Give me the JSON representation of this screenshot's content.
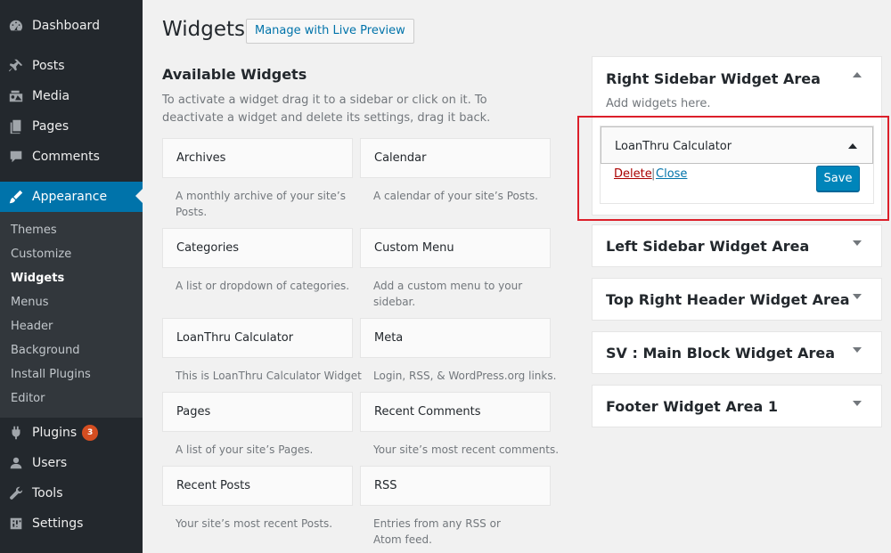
{
  "sidebar": {
    "items": [
      {
        "label": "Dashboard",
        "icon": "dashboard-icon"
      },
      {
        "label": "Posts",
        "icon": "pin-icon"
      },
      {
        "label": "Media",
        "icon": "media-icon"
      },
      {
        "label": "Pages",
        "icon": "pages-icon"
      },
      {
        "label": "Comments",
        "icon": "comment-icon"
      },
      {
        "label": "Appearance",
        "icon": "brush-icon"
      },
      {
        "label": "Plugins",
        "icon": "plugin-icon",
        "badge": "3"
      },
      {
        "label": "Users",
        "icon": "user-icon"
      },
      {
        "label": "Tools",
        "icon": "wrench-icon"
      },
      {
        "label": "Settings",
        "icon": "settings-icon"
      }
    ],
    "submenu": [
      "Themes",
      "Customize",
      "Widgets",
      "Menus",
      "Header",
      "Background",
      "Install Plugins",
      "Editor"
    ],
    "accent": "#0073aa",
    "bg": "#23282d"
  },
  "main": {
    "title": "Widgets",
    "live_preview_button": "Manage with Live Preview",
    "available_title": "Available Widgets",
    "available_desc": "To activate a widget drag it to a sidebar or click on it. To deactivate a widget and delete its settings, drag it back.",
    "widgets": [
      {
        "name": "Archives",
        "desc": "A monthly archive of your site’s Posts."
      },
      {
        "name": "Calendar",
        "desc": "A calendar of your site’s Posts."
      },
      {
        "name": "Categories",
        "desc": "A list or dropdown of categories."
      },
      {
        "name": "Custom Menu",
        "desc": "Add a custom menu to your sidebar."
      },
      {
        "name": "LoanThru Calculator",
        "desc": "This is LoanThru Calculator Widget"
      },
      {
        "name": "Meta",
        "desc": "Login, RSS, & WordPress.org links."
      },
      {
        "name": "Pages",
        "desc": "A list of your site’s Pages."
      },
      {
        "name": "Recent Comments",
        "desc": "Your site’s most recent comments."
      },
      {
        "name": "Recent Posts",
        "desc": "Your site’s most recent Posts."
      },
      {
        "name": "RSS",
        "desc": "Entries from any RSS or Atom feed."
      }
    ]
  },
  "areas": {
    "right_sidebar": {
      "title": "Right Sidebar Widget Area",
      "hint": "Add widgets here."
    },
    "calc_widget": {
      "title": "LoanThru Calculator",
      "delete": "Delete",
      "separator": "|",
      "close": "Close",
      "save": "Save"
    },
    "others": [
      "Left Sidebar Widget Area",
      "Top Right Header Widget Area",
      "SV : Main Block Widget Area",
      "Footer Widget Area 1"
    ]
  }
}
